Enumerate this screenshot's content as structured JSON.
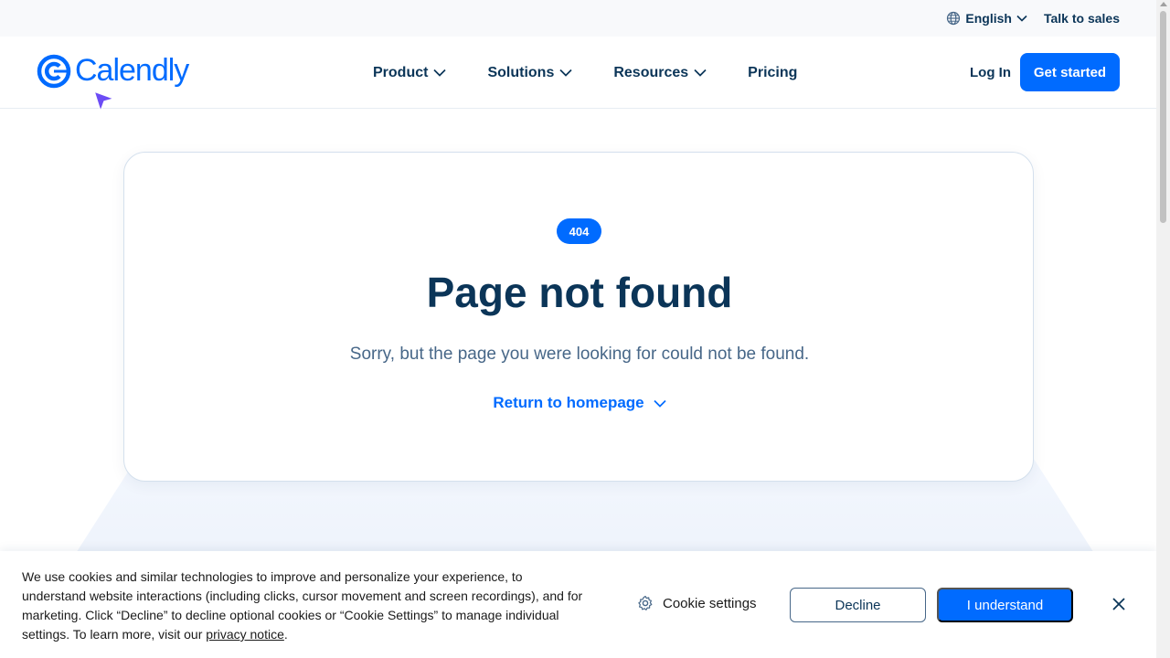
{
  "utility": {
    "language": "English",
    "talk_to_sales": "Talk to sales"
  },
  "header": {
    "logo_text": "Calendly",
    "nav": [
      {
        "label": "Product",
        "has_dropdown": true
      },
      {
        "label": "Solutions",
        "has_dropdown": true
      },
      {
        "label": "Resources",
        "has_dropdown": true
      },
      {
        "label": "Pricing",
        "has_dropdown": false
      }
    ],
    "login": "Log In",
    "get_started": "Get started"
  },
  "error": {
    "badge": "404",
    "title": "Page not found",
    "message": "Sorry, but the page you were looking for could not be found.",
    "return_link": "Return to homepage"
  },
  "cookie": {
    "text": "We use cookies and similar technologies to improve and personalize your experience, to understand website interactions (including clicks, cursor movement and screen recordings), and for marketing. Click “Decline” to decline optional cookies or “Cookie Settings” to manage individual settings. To learn more, visit our ",
    "privacy_link": "privacy notice",
    "text_end": ".",
    "settings": "Cookie settings",
    "decline": "Decline",
    "accept": "I understand"
  },
  "colors": {
    "brand_blue": "#006bff",
    "navy": "#0b3558",
    "muted": "#476788"
  }
}
